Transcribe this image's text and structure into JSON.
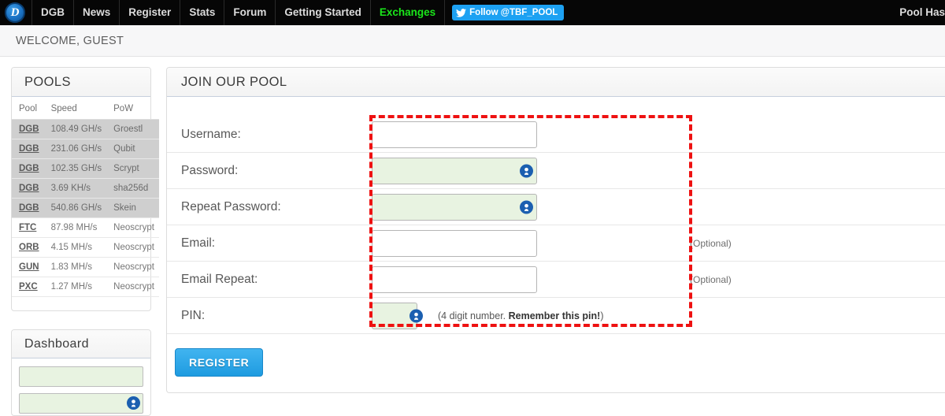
{
  "navbar": {
    "logo_alt": "digibyte-logo",
    "logo_letter": "D",
    "items": [
      {
        "label": "DGB",
        "active": false
      },
      {
        "label": "News",
        "active": false
      },
      {
        "label": "Register",
        "active": false
      },
      {
        "label": "Stats",
        "active": false
      },
      {
        "label": "Forum",
        "active": false
      },
      {
        "label": "Getting Started",
        "active": false
      },
      {
        "label": "Exchanges",
        "active": true
      }
    ],
    "twitter": {
      "label": "Follow @TBF_POOL",
      "icon": "twitter-bird-icon",
      "color": "#1da1f2"
    },
    "right_label": "Pool Has",
    "active_color": "#1ae61a",
    "background": "#060606"
  },
  "welcome": {
    "text": "WELCOME, GUEST"
  },
  "sidebar": {
    "pools": {
      "title": "POOLS",
      "columns": [
        "Pool",
        "Speed",
        "PoW"
      ],
      "rows": [
        {
          "pool": "DGB",
          "speed": "108.49 GH/s",
          "pow": "Groestl",
          "shaded": true
        },
        {
          "pool": "DGB",
          "speed": "231.06 GH/s",
          "pow": "Qubit",
          "shaded": true
        },
        {
          "pool": "DGB",
          "speed": "102.35 GH/s",
          "pow": "Scrypt",
          "shaded": true
        },
        {
          "pool": "DGB",
          "speed": "3.69 KH/s",
          "pow": "sha256d",
          "shaded": true
        },
        {
          "pool": "DGB",
          "speed": "540.86 GH/s",
          "pow": "Skein",
          "shaded": true
        },
        {
          "pool": "FTC",
          "speed": "87.98 MH/s",
          "pow": "Neoscrypt",
          "shaded": false
        },
        {
          "pool": "ORB",
          "speed": "4.15 MH/s",
          "pow": "Neoscrypt",
          "shaded": false
        },
        {
          "pool": "GUN",
          "speed": "1.83 MH/s",
          "pow": "Neoscrypt",
          "shaded": false
        },
        {
          "pool": "PXC",
          "speed": "1.27 MH/s",
          "pow": "Neoscrypt",
          "shaded": false
        }
      ]
    },
    "dashboard": {
      "title": "Dashboard",
      "fields": [
        {
          "name": "dashboard-username-input",
          "value": "",
          "has_icon": false
        },
        {
          "name": "dashboard-password-input",
          "value": "",
          "has_icon": true
        }
      ]
    }
  },
  "main": {
    "title": "JOIN OUR POOL",
    "fields": [
      {
        "label": "Username:",
        "name": "username",
        "value": "",
        "green": false,
        "lastpass_icon": false,
        "note": ""
      },
      {
        "label": "Password:",
        "name": "password",
        "value": "",
        "green": true,
        "lastpass_icon": true,
        "note": ""
      },
      {
        "label": "Repeat Password:",
        "name": "repeat-password",
        "value": "",
        "green": true,
        "lastpass_icon": true,
        "note": ""
      },
      {
        "label": "Email:",
        "name": "email",
        "value": "",
        "green": false,
        "lastpass_icon": false,
        "note": "(Optional)"
      },
      {
        "label": "Email Repeat:",
        "name": "email-repeat",
        "value": "",
        "green": false,
        "lastpass_icon": false,
        "note": "(Optional)"
      }
    ],
    "pin": {
      "label": "PIN:",
      "value": "",
      "lastpass_icon": true,
      "hint_prefix": "(4 digit number. ",
      "hint_bold": "Remember this pin!",
      "hint_suffix": ")"
    },
    "register_button": "REGISTER"
  },
  "annotation": {
    "name": "red-dashed-highlight-box",
    "color": "#ee1111",
    "style": "dashed"
  }
}
